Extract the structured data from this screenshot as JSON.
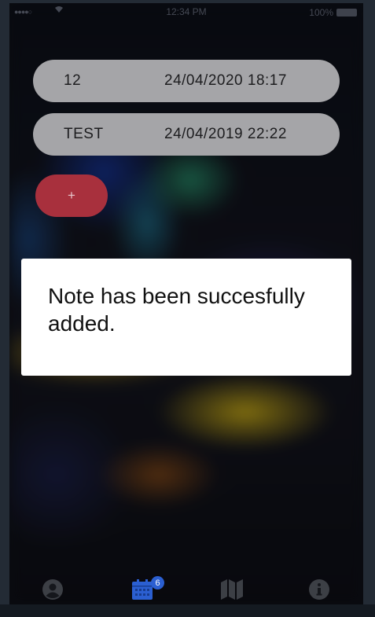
{
  "status_bar": {
    "signal": "●●●●○",
    "time": "12:34 PM",
    "battery": "100%"
  },
  "notes": [
    {
      "title": "12",
      "date": "24/04/2020 18:17"
    },
    {
      "title": "TEST",
      "date": "24/04/2019 22:22"
    }
  ],
  "add_button": {
    "label": "+"
  },
  "toast": {
    "message": "Note has been succesfully added."
  },
  "tab_bar": {
    "tabs": [
      {
        "icon": "profile-icon",
        "active": false
      },
      {
        "icon": "calendar-icon",
        "active": true
      },
      {
        "icon": "map-icon",
        "active": false
      },
      {
        "icon": "info-icon",
        "active": false
      }
    ],
    "calendar_badge": "6"
  },
  "colors": {
    "note_pill": "#a5a5a8",
    "add_button": "#a8303d",
    "active_tab": "#2b5fd1",
    "inactive_tab": "#3c3f45"
  }
}
